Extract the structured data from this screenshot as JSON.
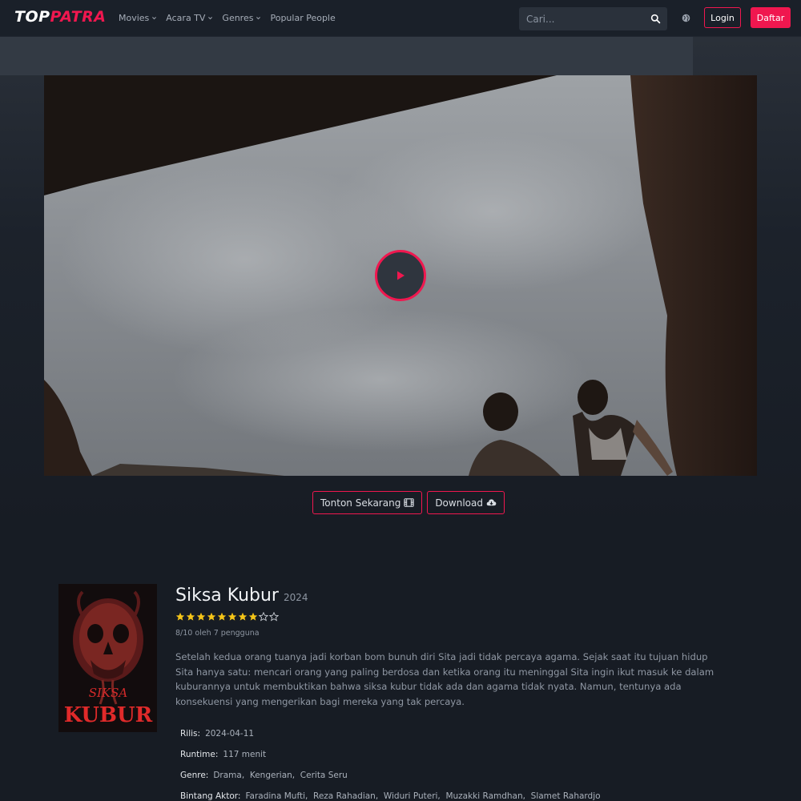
{
  "header": {
    "logo_part1": "TOP",
    "logo_part2": "PATRA",
    "nav": [
      {
        "label": "Movies",
        "dropdown": true
      },
      {
        "label": "Acara TV",
        "dropdown": true
      },
      {
        "label": "Genres",
        "dropdown": true
      },
      {
        "label": "Popular People",
        "dropdown": false
      }
    ],
    "search_placeholder": "Cari...",
    "login_label": "Login",
    "register_label": "Daftar"
  },
  "player": {
    "watch_label": "Tonton Sekarang",
    "download_label": "Download"
  },
  "movie": {
    "title": "Siksa Kubur",
    "year": "2024",
    "rating": 8,
    "rating_max": 10,
    "rating_text": "8/10 oleh 7 pengguna",
    "poster_text_1": "SIKSA",
    "poster_text_2": "KUBUR",
    "overview": "Setelah kedua orang tuanya jadi korban bom bunuh diri Sita jadi tidak percaya agama. Sejak saat itu tujuan hidup Sita hanya satu: mencari orang yang paling berdosa dan ketika orang itu meninggal Sita ingin ikut masuk ke dalam kuburannya untuk membuktikan bahwa siksa kubur tidak ada dan agama tidak nyata. Namun, tentunya ada konsekuensi yang mengerikan bagi mereka yang tak percaya.",
    "facts": {
      "release_label": "Rilis:",
      "release_value": "2024-04-11",
      "runtime_label": "Runtime:",
      "runtime_value": "117 menit",
      "genre_label": "Genre:",
      "genre_value": "Drama,  Kengerian,  Cerita Seru",
      "cast_label": "Bintang Aktor:",
      "cast_value": "Faradina Mufti,  Reza Rahadian,  Widuri Puteri,  Muzakki Ramdhan,  Slamet Rahardjo"
    }
  },
  "colors": {
    "accent": "#f0174f",
    "background": "#171c24",
    "star": "#f5c518"
  }
}
